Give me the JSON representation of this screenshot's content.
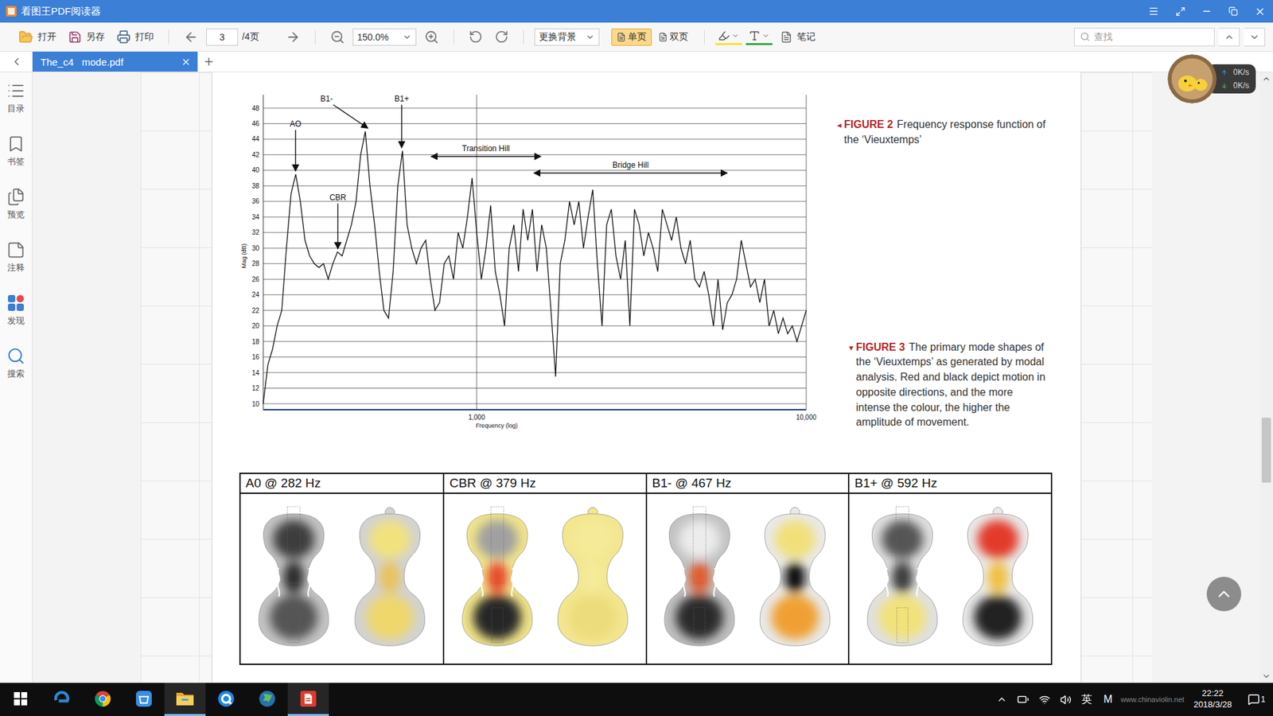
{
  "window": {
    "title": "看图王PDF阅读器"
  },
  "toolbar": {
    "file_actions": [
      {
        "label": "打开",
        "kind": "open"
      },
      {
        "label": "另存",
        "kind": "save"
      },
      {
        "label": "打印",
        "kind": "print"
      }
    ],
    "page": {
      "current": "3",
      "total": "/4页"
    },
    "zoom": "150.0%",
    "background": "更换背景",
    "view_modes": [
      {
        "label": "单页",
        "selected": true
      },
      {
        "label": "双页",
        "selected": false
      }
    ],
    "note": "笔记",
    "search": {
      "placeholder": "查找"
    }
  },
  "tabs": [
    {
      "label": "The_c4   mode.pdf",
      "selected": true
    }
  ],
  "sidebar": {
    "items": [
      {
        "label": "目录",
        "kind": "toc"
      },
      {
        "label": "书签",
        "kind": "bookmark"
      },
      {
        "label": "预览",
        "kind": "preview"
      },
      {
        "label": "注释",
        "kind": "notes"
      },
      {
        "label": "发现",
        "kind": "discover"
      },
      {
        "label": "搜索",
        "kind": "search"
      }
    ]
  },
  "document": {
    "figure2": {
      "marker": "◂",
      "label": "FIGURE 2",
      "text": "Frequency response function of the ‘Vieuxtemps’",
      "chart": {
        "y_label": "Mag (dB)",
        "x_label": "Frequency (log)",
        "y_min": 10,
        "y_max": 48,
        "x_min_hz": 225,
        "x_max_hz": 10000,
        "y_ticks": [
          "10",
          "12",
          "14",
          "16",
          "18",
          "20",
          "22",
          "24",
          "26",
          "28",
          "30",
          "32",
          "34",
          "36",
          "38",
          "40",
          "42",
          "44",
          "46",
          "48"
        ],
        "x_ticks": [
          {
            "label": "1,000",
            "hz": 1000
          },
          {
            "label": "10,000",
            "hz": 10000
          }
        ],
        "peaks": [
          {
            "label": "AO",
            "at_hz": 282
          },
          {
            "label": "CBR",
            "at_hz": 379
          },
          {
            "label": "B1-",
            "at_hz": 467
          },
          {
            "label": "B1+",
            "at_hz": 592
          }
        ],
        "hills": [
          {
            "label": "Transition Hill",
            "from_hz": 728,
            "to_hz": 1563
          },
          {
            "label": "Bridge Hill",
            "from_hz": 1494,
            "to_hz": 5750
          }
        ],
        "series": {
          "name": "Vieuxtemps",
          "values": [
            10,
            15,
            17,
            20,
            22,
            30,
            37,
            39.5,
            36,
            31,
            29,
            28,
            27.5,
            28,
            26,
            28,
            29.5,
            29,
            31,
            33,
            36,
            42,
            45,
            38,
            33,
            27,
            22,
            21,
            27,
            38,
            42.5,
            33,
            30,
            28,
            30,
            31,
            26,
            22,
            23,
            28,
            29,
            26,
            32,
            30,
            34,
            39,
            32,
            26,
            30,
            35.5,
            27,
            24,
            20,
            30,
            33,
            27,
            35,
            31,
            35,
            27,
            33,
            30,
            22,
            13.5,
            28,
            31,
            36,
            33,
            36,
            30,
            34,
            37.5,
            28,
            20,
            33,
            35,
            29,
            26,
            31,
            20,
            35,
            33,
            29,
            32,
            30,
            27,
            35,
            33,
            31,
            34,
            30,
            28,
            31,
            26,
            25,
            27,
            24,
            20,
            26,
            19.5,
            23,
            24,
            26,
            31,
            28,
            25,
            26,
            23,
            26,
            20,
            22,
            19,
            21,
            19,
            20,
            18,
            20,
            22
          ]
        }
      }
    },
    "figure3": {
      "marker": "▾",
      "label": "FIGURE 3",
      "text": "The primary mode shapes of the ‘Vieuxtemps’ as generated by modal analysis. Red and black depict motion in opposite directions, and the more intense the colour, the higher the amplitude of movement.",
      "modes": [
        {
          "title": "A0 @ 282 Hz",
          "views": [
            {
              "kind": "front",
              "tints": [
                "#c4c4c4",
                "#3e3e3e",
                "#555555",
                "#2c2c2c"
              ]
            },
            {
              "kind": "back",
              "tints": [
                "#d2d2d2",
                "#f2e27e",
                "#efd76c",
                "#e9c25c"
              ]
            }
          ]
        },
        {
          "title": "CBR @ 379 Hz",
          "views": [
            {
              "kind": "front",
              "tints": [
                "#f1e48a",
                "#a0a0a0",
                "#262626",
                "#e84a2a"
              ]
            },
            {
              "kind": "back",
              "tints": [
                "#f3e68f",
                "#f4ea98",
                "#eddc7b",
                "#f5eb9c"
              ]
            }
          ]
        },
        {
          "title": "B1- @ 467 Hz",
          "views": [
            {
              "kind": "front",
              "tints": [
                "#c2c2c2",
                "#ececec",
                "#2a2a2a",
                "#e05a2a"
              ]
            },
            {
              "kind": "back",
              "tints": [
                "#e9e9e9",
                "#f1e07a",
                "#f0a030",
                "#111111"
              ]
            }
          ]
        },
        {
          "title": "B1+ @ 592 Hz",
          "views": [
            {
              "kind": "front",
              "tints": [
                "#e0e0e0",
                "#555555",
                "#f2e27a",
                "#3a3a3a"
              ]
            },
            {
              "kind": "back",
              "tints": [
                "#eaeaea",
                "#e23a2a",
                "#222222",
                "#f0c040"
              ]
            }
          ]
        }
      ]
    }
  },
  "scroll": {
    "level": 0.64
  },
  "network_widget": {
    "upload": "0K/s",
    "download": "0K/s"
  },
  "taskbar": {
    "apps": [
      {
        "kind": "start",
        "active": false
      },
      {
        "kind": "edge",
        "active": false
      },
      {
        "kind": "chrome",
        "active": false
      },
      {
        "kind": "store",
        "active": false
      },
      {
        "kind": "explorer",
        "active": true
      },
      {
        "kind": "browser",
        "active": false
      },
      {
        "kind": "globe",
        "active": false
      },
      {
        "kind": "pdf",
        "active": true
      }
    ],
    "ime": "英",
    "tray_letter": "M",
    "watermark": "www.chinaviolin.net",
    "time": "22:22",
    "date": "2018/3/28",
    "notifications": "1"
  }
}
